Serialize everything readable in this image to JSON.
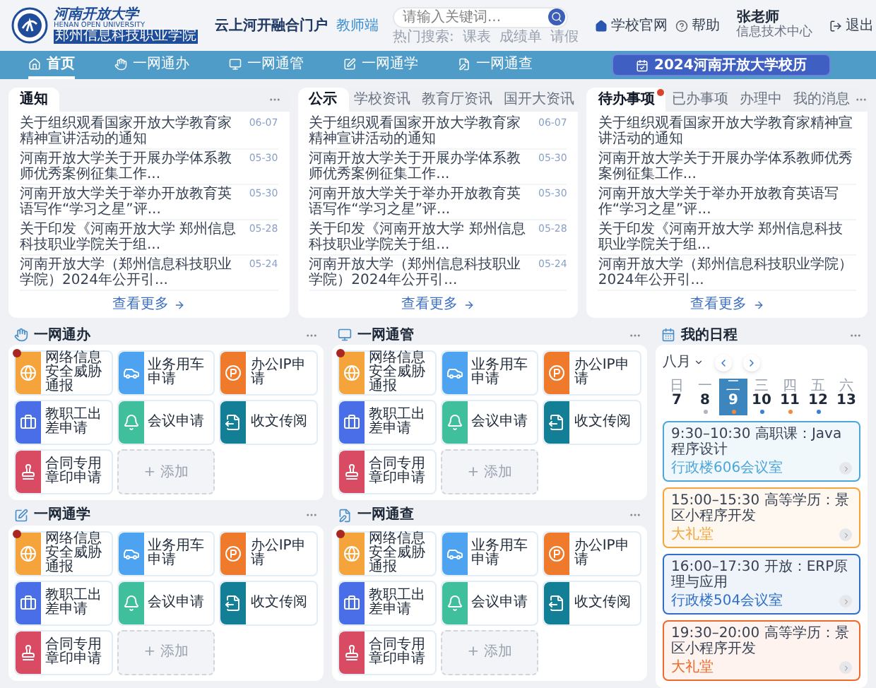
{
  "header": {
    "school_name": "河南开放大学",
    "school_name_en": "HENAN OPEN UNIVERSITY",
    "college_name": "郑州信息科技职业学院",
    "portal_title": "云上河开融合门户",
    "portal_role": "教师端",
    "search": {
      "placeholder": "请输入关键词..."
    },
    "hot_search_label": "热门搜索:",
    "hot_search": [
      "课表",
      "成绩单",
      "请假"
    ],
    "links": [
      {
        "kind": "home",
        "label": "学校官网"
      },
      {
        "kind": "help",
        "label": "帮助"
      }
    ],
    "user": {
      "name": "张老师",
      "department": "信息技术中心"
    },
    "logout": "退出"
  },
  "nav": {
    "items": [
      {
        "label": "首页",
        "selected": true
      },
      {
        "label": "一网通办",
        "selected": false
      },
      {
        "label": "一网通管",
        "selected": false
      },
      {
        "label": "一网通学",
        "selected": false
      },
      {
        "label": "一网通查",
        "selected": false
      }
    ],
    "calendar_button": "2024河南开放大学校历"
  },
  "news_cards": [
    {
      "tabs": [
        {
          "label": "通知",
          "selected": true,
          "badge": false
        }
      ],
      "items": [
        {
          "title": "关于组织观看国家开放大学教育家精神宣讲活动的通知",
          "date": "06-07"
        },
        {
          "title": "河南开放大学关于开展办学体系教师优秀案例征集工作...",
          "date": "05-30"
        },
        {
          "title": "河南开放大学关于举办开放教育英语写作“学习之星”评...",
          "date": "05-30"
        },
        {
          "title": "关于印发《河南开放大学 郑州信息科技职业学院关于组...",
          "date": "05-28"
        },
        {
          "title": "河南开放大学（郑州信息科技职业学院）2024年公开引...",
          "date": "05-24"
        }
      ],
      "more": "查看更多"
    },
    {
      "tabs": [
        {
          "label": "公示",
          "selected": true,
          "badge": false
        },
        {
          "label": "学校资讯",
          "selected": false,
          "badge": false
        },
        {
          "label": "教育厅资讯",
          "selected": false,
          "badge": false
        },
        {
          "label": "国开大资讯",
          "selected": false,
          "badge": false
        }
      ],
      "items": [
        {
          "title": "关于组织观看国家开放大学教育家精神宣讲活动的通知",
          "date": "06-07"
        },
        {
          "title": "河南开放大学关于开展办学体系教师优秀案例征集工作...",
          "date": "05-30"
        },
        {
          "title": "河南开放大学关于举办开放教育英语写作“学习之星”评...",
          "date": "05-30"
        },
        {
          "title": "关于印发《河南开放大学 郑州信息科技职业学院关于组...",
          "date": "05-28"
        },
        {
          "title": "河南开放大学（郑州信息科技职业学院）2024年公开引...",
          "date": "05-24"
        }
      ],
      "more": "查看更多"
    },
    {
      "tabs": [
        {
          "label": "待办事项",
          "selected": true,
          "badge": true
        },
        {
          "label": "已办事项",
          "selected": false,
          "badge": false
        },
        {
          "label": "办理中",
          "selected": false,
          "badge": false
        },
        {
          "label": "我的消息",
          "selected": false,
          "badge": false
        }
      ],
      "items": [
        {
          "title": "关于组织观看国家开放大学教育家精神宣讲活动的通知"
        },
        {
          "title": "河南开放大学关于开展办学体系教师优秀案例征集工作..."
        },
        {
          "title": "河南开放大学关于举办开放教育英语写作“学习之星”评..."
        },
        {
          "title": "关于印发《河南开放大学 郑州信息科技职业学院关于组..."
        },
        {
          "title": "河南开放大学（郑州信息科技职业学院）2024年公开引..."
        }
      ],
      "more": "查看更多"
    }
  ],
  "sections": [
    {
      "title": "一网通办",
      "tiles": [
        {
          "kind": "app",
          "label": "网络信息安全威胁通报",
          "color": "#f5a33b",
          "badge": true
        },
        {
          "kind": "app",
          "label": "业务用车申请",
          "color": "#4da3f0",
          "badge": false
        },
        {
          "kind": "app",
          "label": "办公IP申请",
          "color": "#ef7a2c",
          "badge": false
        },
        {
          "kind": "app",
          "label": "教职工出差申请",
          "color": "#4a6ee8",
          "badge": false
        },
        {
          "kind": "app",
          "label": "会议申请",
          "color": "#3fbf9b",
          "badge": false
        },
        {
          "kind": "app",
          "label": "收文传阅",
          "color": "#137f96",
          "badge": false
        },
        {
          "kind": "app",
          "label": "合同专用章印申请",
          "color": "#d94b63",
          "badge": false
        },
        {
          "kind": "add",
          "label": "+ 添加"
        }
      ]
    },
    {
      "title": "一网通管",
      "tiles": [
        {
          "kind": "app",
          "label": "网络信息安全威胁通报",
          "color": "#f5a33b",
          "badge": true
        },
        {
          "kind": "app",
          "label": "业务用车申请",
          "color": "#4da3f0",
          "badge": false
        },
        {
          "kind": "app",
          "label": "办公IP申请",
          "color": "#ef7a2c",
          "badge": false
        },
        {
          "kind": "app",
          "label": "教职工出差申请",
          "color": "#4a6ee8",
          "badge": false
        },
        {
          "kind": "app",
          "label": "会议申请",
          "color": "#3fbf9b",
          "badge": false
        },
        {
          "kind": "app",
          "label": "收文传阅",
          "color": "#137f96",
          "badge": false
        },
        {
          "kind": "app",
          "label": "合同专用章印申请",
          "color": "#d94b63",
          "badge": false
        },
        {
          "kind": "add",
          "label": "+ 添加"
        }
      ]
    },
    {
      "title": "一网通学",
      "tiles": [
        {
          "kind": "app",
          "label": "网络信息安全威胁通报",
          "color": "#f5a33b",
          "badge": true
        },
        {
          "kind": "app",
          "label": "业务用车申请",
          "color": "#4da3f0",
          "badge": false
        },
        {
          "kind": "app",
          "label": "办公IP申请",
          "color": "#ef7a2c",
          "badge": false
        },
        {
          "kind": "app",
          "label": "教职工出差申请",
          "color": "#4a6ee8",
          "badge": false
        },
        {
          "kind": "app",
          "label": "会议申请",
          "color": "#3fbf9b",
          "badge": false
        },
        {
          "kind": "app",
          "label": "收文传阅",
          "color": "#137f96",
          "badge": false
        },
        {
          "kind": "app",
          "label": "合同专用章印申请",
          "color": "#d94b63",
          "badge": false
        },
        {
          "kind": "add",
          "label": "+ 添加"
        }
      ]
    },
    {
      "title": "一网通查",
      "tiles": [
        {
          "kind": "app",
          "label": "网络信息安全威胁通报",
          "color": "#f5a33b",
          "badge": true
        },
        {
          "kind": "app",
          "label": "业务用车申请",
          "color": "#4da3f0",
          "badge": false
        },
        {
          "kind": "app",
          "label": "办公IP申请",
          "color": "#ef7a2c",
          "badge": false
        },
        {
          "kind": "app",
          "label": "教职工出差申请",
          "color": "#4a6ee8",
          "badge": false
        },
        {
          "kind": "app",
          "label": "会议申请",
          "color": "#3fbf9b",
          "badge": false
        },
        {
          "kind": "app",
          "label": "收文传阅",
          "color": "#137f96",
          "badge": false
        },
        {
          "kind": "app",
          "label": "合同专用章印申请",
          "color": "#d94b63",
          "badge": false
        },
        {
          "kind": "add",
          "label": "+ 添加"
        }
      ]
    }
  ],
  "schedule": {
    "title": "我的日程",
    "month": "八月",
    "days": [
      {
        "weekday": "日",
        "date": "7",
        "selected": false
      },
      {
        "weekday": "一",
        "date": "8",
        "selected": false,
        "color": "#b0b6bf"
      },
      {
        "weekday": "二",
        "date": "9",
        "selected": true,
        "color": "#f08a3c"
      },
      {
        "weekday": "三",
        "date": "10",
        "selected": false,
        "color": "#3d7fd6"
      },
      {
        "weekday": "四",
        "date": "11",
        "selected": false,
        "color": "#f08a3c"
      },
      {
        "weekday": "五",
        "date": "12",
        "selected": false,
        "color": "#3d7fd6"
      },
      {
        "weekday": "六",
        "date": "13",
        "selected": false
      }
    ],
    "events": [
      {
        "time": "9:30–10:30",
        "title": "高职课：Java程序设计",
        "location": "行政楼606会议室",
        "color": "#4da6d9"
      },
      {
        "time": "15:00–15:30",
        "title": "高等学历：景区小程序开发",
        "location": "大礼堂",
        "color": "#f5a33b"
      },
      {
        "time": "16:00–17:30",
        "title": "开放：ERP原理与应用",
        "location": "行政楼504会议室",
        "color": "#2f6fc9"
      },
      {
        "time": "19:30–20:00",
        "title": "高等学历：景区小程序开发",
        "location": "大礼堂",
        "color": "#ee6a2a"
      }
    ]
  }
}
